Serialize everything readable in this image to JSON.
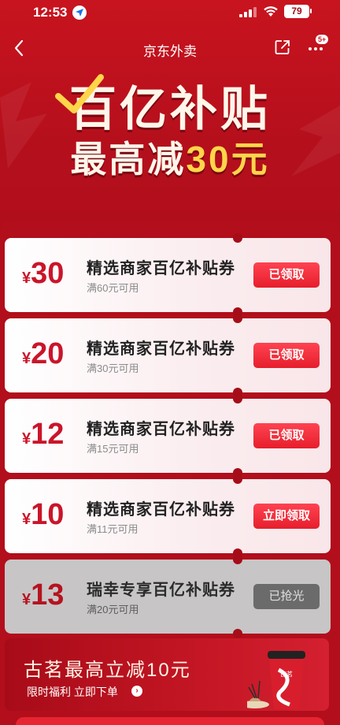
{
  "status_bar": {
    "time": "12:53",
    "battery": "79"
  },
  "nav": {
    "title": "京东外卖",
    "more_badge": "5+"
  },
  "hero": {
    "title": "百亿补贴",
    "sub_prefix": "最高减",
    "sub_amount": "30元"
  },
  "coupons": [
    {
      "currency": "¥",
      "amount": "30",
      "name": "精选商家百亿补贴券",
      "condition": "满60元可用",
      "button": "已领取",
      "state": "claimed"
    },
    {
      "currency": "¥",
      "amount": "20",
      "name": "精选商家百亿补贴券",
      "condition": "满30元可用",
      "button": "已领取",
      "state": "claimed"
    },
    {
      "currency": "¥",
      "amount": "12",
      "name": "精选商家百亿补贴券",
      "condition": "满15元可用",
      "button": "已领取",
      "state": "claimed"
    },
    {
      "currency": "¥",
      "amount": "10",
      "name": "精选商家百亿补贴券",
      "condition": "满11元可用",
      "button": "立即领取",
      "state": "available"
    },
    {
      "currency": "¥",
      "amount": "13",
      "name": "瑞幸专享百亿补贴券",
      "condition": "满20元可用",
      "button": "已抢光",
      "state": "sold_out"
    }
  ],
  "promo": {
    "title": "古茗最高立减10元",
    "subtitle": "限时福利 立即下单",
    "arrow_icon": "chevron-right-icon",
    "cup_label": "古茗"
  },
  "colors": {
    "brand_red": "#c8141f",
    "accent_gold": "#ffd54a",
    "button_red": "#e61e2c",
    "disabled_gray": "#6b6b6b"
  }
}
